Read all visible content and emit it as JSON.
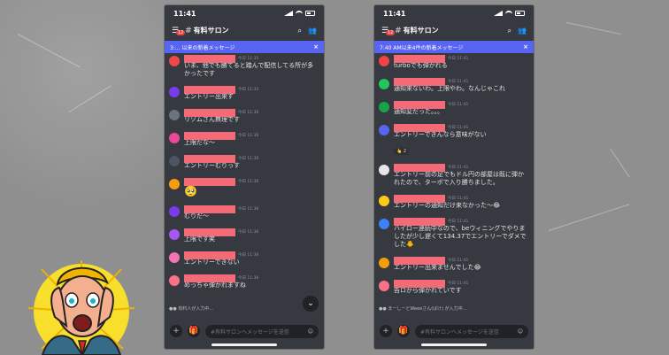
{
  "phones": [
    {
      "time": "11:41",
      "badge": "12",
      "channel": "有料サロン",
      "new_banner": "3:... 以来の新着メッセージ",
      "messages": [
        {
          "time": "今日 11:35",
          "text": "いま、他でも勝てると踏んで配信してる所が多かったです",
          "avatar": "#f04747"
        },
        {
          "time": "今日 11:35",
          "text": "エントリー出来ず",
          "avatar": "#7c3aed"
        },
        {
          "time": "今日 11:36",
          "text": "リゾムさん無理です",
          "avatar": "#6b7280"
        },
        {
          "time": "今日 11:36",
          "text": "上限だな～",
          "avatar": "#ec4899"
        },
        {
          "time": "今日 11:36",
          "text": "エントリーむりっす",
          "avatar": "#4b5563"
        },
        {
          "time": "今日 11:36",
          "text": "🥺",
          "avatar": "#f59e0b",
          "big": true
        },
        {
          "time": "今日 11:36",
          "text": "むりだ～",
          "avatar": "#7c3aed"
        },
        {
          "time": "今日 11:36",
          "text": "上限です笑",
          "avatar": "#a855f7"
        },
        {
          "time": "今日 11:36",
          "text": "エントリーできない",
          "avatar": "#f472b6"
        },
        {
          "time": "今日 11:36",
          "text": "めっちゃ弾かれますね",
          "avatar": "#fb7185"
        }
      ],
      "typing": "●● 有料人が入力中...",
      "composer_placeholder": "#有料サロンへメッセージを送信"
    },
    {
      "time": "11:41",
      "badge": "12",
      "channel": "有料サロン",
      "new_banner": "7:40 AM以来4件の新着メッセージ",
      "messages": [
        {
          "time": "今日 11:41",
          "text": "turboでも弾かれる",
          "avatar": "#ef4444"
        },
        {
          "time": "今日 11:41",
          "text": "通知来ないわ。上限やわ。なんじゃこれ",
          "avatar": "#22c55e"
        },
        {
          "time": "今日 11:41",
          "text": "通知変だった。。。",
          "avatar": "#16a34a"
        },
        {
          "time": "今日 11:41",
          "text": "エントリーできんなら意味がない",
          "avatar": "#5865f2",
          "reaction": "👆 2"
        },
        {
          "time": "今日 11:41",
          "text": "エントリー前の足でもドル円の部屋は既に弾かれたので、ターボで入り勝ちました。",
          "avatar": "#e5e7eb"
        },
        {
          "time": "今日 11:41",
          "text": "エントリーの通知だけ来なかった～😂",
          "avatar": "#facc15"
        },
        {
          "time": "今日 11:41",
          "text": "ハイロー連続中なので、beウィニングでやりましたが少し遅くて134.37でエントリーでダメでした🐥",
          "avatar": "#3b82f6"
        },
        {
          "time": "今日 11:41",
          "text": "エントリー出来ませんでした😂",
          "avatar": "#f59e0b"
        },
        {
          "time": "今日 11:41",
          "text": "告ロから弾かれていです",
          "avatar": "#fb7185"
        }
      ],
      "typing": "●● まーしーとWeeeさん(ばけ) が入力中...",
      "composer_placeholder": "#有料サロンへメッセージを送信"
    }
  ]
}
